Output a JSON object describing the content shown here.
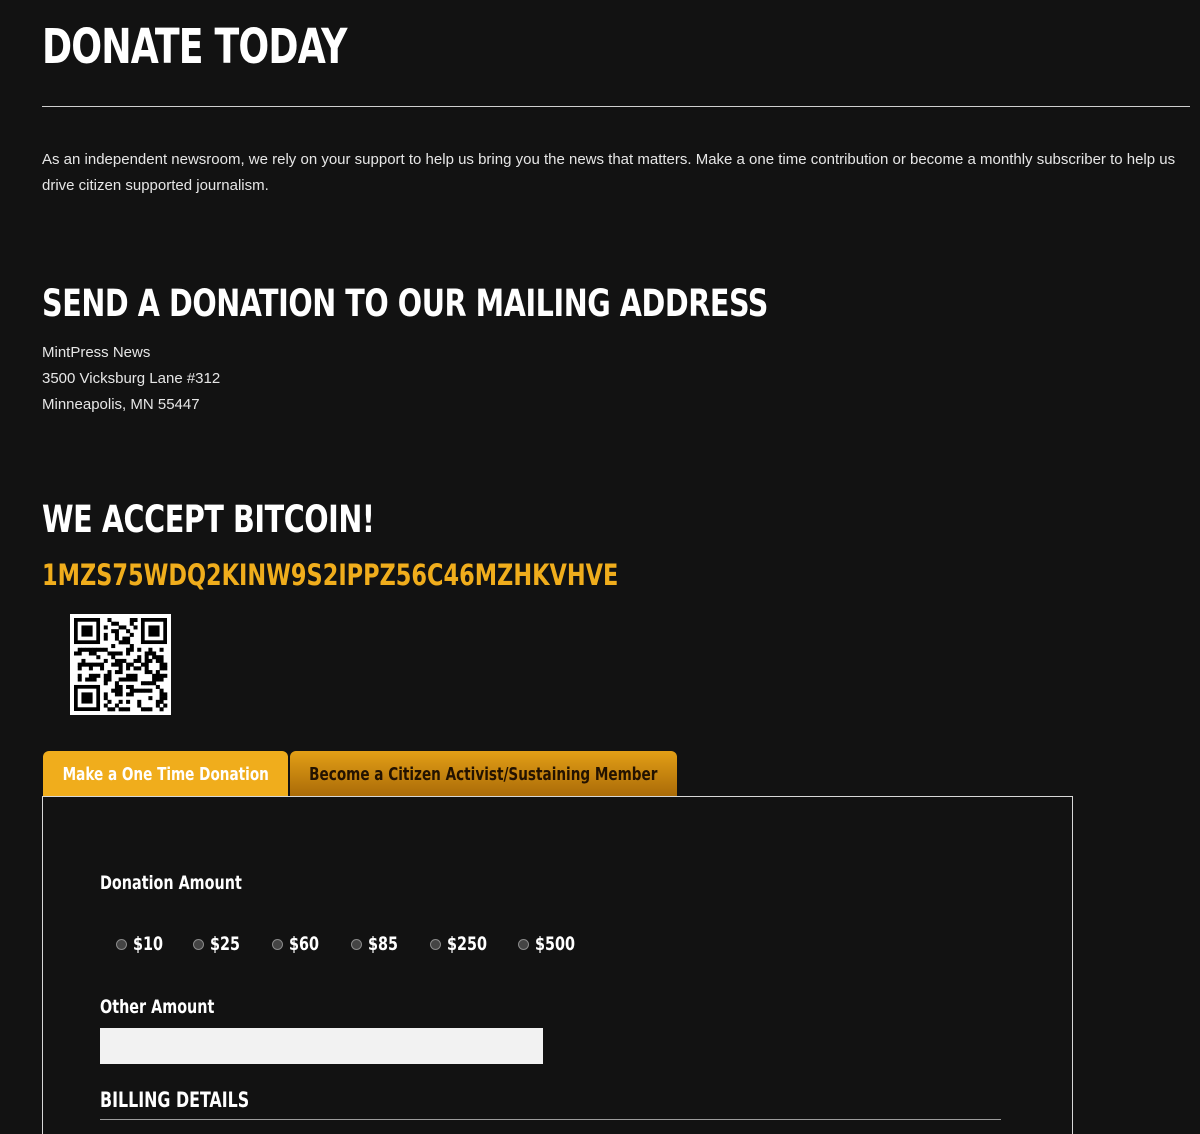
{
  "header": {
    "title": "DONATE TODAY",
    "intro": "As an independent newsroom, we rely on your support to help us bring you the news that matters. Make a one time contribution or become a monthly subscriber to help us drive citizen supported journalism."
  },
  "mailing": {
    "title": "SEND A DONATION TO OUR MAILING ADDRESS",
    "lines": [
      "MintPress News",
      "3500 Vicksburg Lane #312",
      "Minneapolis, MN 55447"
    ]
  },
  "bitcoin": {
    "title": "WE ACCEPT BITCOIN!",
    "address": "1MZS75WDQ2KINW9S2IPPZ56C46MZHKVHVE",
    "qr_icon": "qr-code-icon",
    "accent_color": "#f0ad1c"
  },
  "tabs": [
    {
      "label": "Make a One Time Donation",
      "active": true
    },
    {
      "label": "Become a Citizen Activist/Sustaining Member",
      "active": false
    }
  ],
  "form": {
    "donation_amount_label": "Donation Amount",
    "amounts": [
      "$10",
      "$25",
      "$60",
      "$85",
      "$250",
      "$500"
    ],
    "other_amount_label": "Other Amount",
    "other_amount_value": "",
    "billing_title": "BILLING DETAILS"
  },
  "colors": {
    "background": "#121212",
    "accent": "#f0ad1c",
    "text": "#ffffff"
  }
}
